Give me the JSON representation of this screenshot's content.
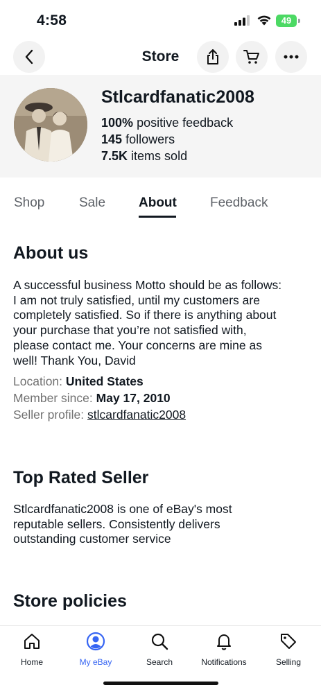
{
  "status_bar": {
    "time": "4:58",
    "battery": "49"
  },
  "nav": {
    "title": "Store"
  },
  "store": {
    "name": "Stlcardfanatic2008",
    "feedback_value": "100%",
    "feedback_label": "positive feedback",
    "followers_value": "145",
    "followers_label": "followers",
    "sold_value": "7.5K",
    "sold_label": "items sold"
  },
  "tabs": [
    {
      "label": "Shop"
    },
    {
      "label": "Sale"
    },
    {
      "label": "About",
      "active": true
    },
    {
      "label": "Feedback"
    }
  ],
  "about": {
    "heading": "About us",
    "lines": [
      "A successful business Motto should be as follows:",
      "I am not truly satisfied, until my customers are",
      "completely satisfied. So if there is anything about",
      "your purchase that you’re not satisfied with,",
      "please contact me. Your concerns are mine as",
      "well! Thank You, David"
    ],
    "location_label": "Location:",
    "location_value": "United States",
    "member_label": "Member since:",
    "member_value": "May 17, 2010",
    "profile_label": "Seller profile:",
    "profile_value": "stlcardfanatic2008"
  },
  "top_rated": {
    "heading": "Top Rated Seller",
    "lines": [
      "Stlcardfanatic2008 is one of eBay's most",
      "reputable sellers. Consistently delivers",
      "outstanding customer service"
    ]
  },
  "policies": {
    "heading": "Store policies"
  },
  "bottom_nav": [
    {
      "label": "Home",
      "icon": "home-icon"
    },
    {
      "label": "My eBay",
      "icon": "account-icon",
      "active": true
    },
    {
      "label": "Search",
      "icon": "search-icon"
    },
    {
      "label": "Notifications",
      "icon": "bell-icon"
    },
    {
      "label": "Selling",
      "icon": "tag-icon"
    }
  ],
  "colors": {
    "accent": "#3665f3",
    "text": "#111820",
    "muted": "#707070",
    "band": "#f5f5f5"
  }
}
